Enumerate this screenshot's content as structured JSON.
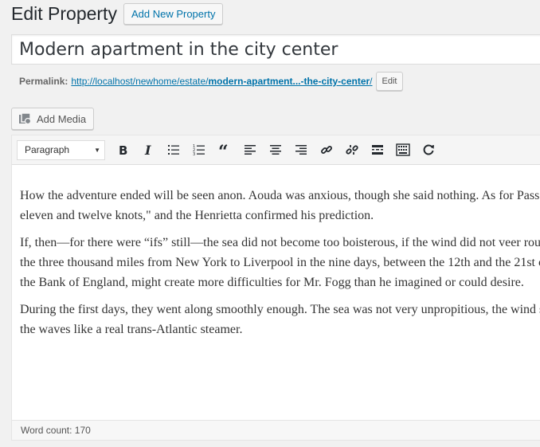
{
  "header": {
    "title": "Edit Property",
    "add_new_label": "Add New Property"
  },
  "post_title": "Modern apartment in the city center",
  "permalink": {
    "label": "Permalink:",
    "url_prefix": "http://localhost/newhome/estate/",
    "url_slug": "modern-apartment...-the-city-center",
    "url_suffix": "/",
    "edit_label": "Edit"
  },
  "media": {
    "add_media_label": "Add Media"
  },
  "toolbar": {
    "format_value": "Paragraph",
    "buttons": [
      "bold-icon",
      "italic-icon",
      "bulleted-list-icon",
      "numbered-list-icon",
      "blockquote-icon",
      "align-left-icon",
      "align-center-icon",
      "align-right-icon",
      "link-icon",
      "unlink-icon",
      "read-more-icon",
      "toolbar-toggle-icon",
      "fullscreen-icon"
    ]
  },
  "content": {
    "paragraphs": [
      [
        "How the adventure ended will be seen anon. Aouda was anxious, though she said nothing. As for Passepartout, he thought Mr. Fogg's manoeuvre simply glorious. The captain had said \"between",
        "eleven and twelve knots,\" and the Henrietta confirmed his prediction."
      ],
      [
        "If, then—for there were “ifs” still—the sea did not become too boisterous, if the wind did not veer round to the east, if no accident happened to the boat or its machinery, the Henrietta might cross",
        "the three thousand miles from New York to Liverpool in the nine days, between the 12th and the 21st of December. It is true that, once arrived, the affair on board the Henrietta, added to that of",
        "the Bank of England, might create more difficulties for Mr. Fogg than he imagined or could desire."
      ],
      [
        "During the first days, they went along smoothly enough. The sea was not very unpropitious, the wind seemed stationary in the north-east, the sails were hoisted, and the Henrietta ploughed across",
        "the waves like a real trans-Atlantic steamer."
      ]
    ]
  },
  "status": {
    "word_count": "Word count: 170"
  }
}
